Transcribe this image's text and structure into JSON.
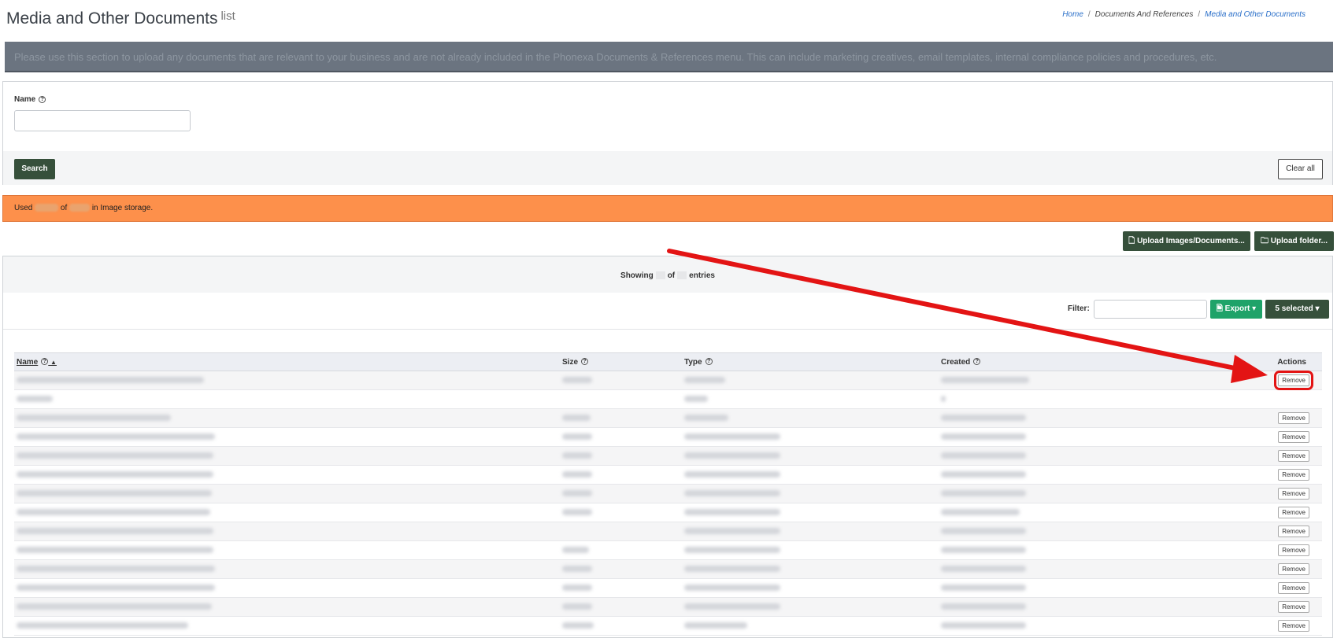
{
  "header": {
    "title": "Media and Other Documents",
    "subtitle": "list",
    "breadcrumb": [
      "Home",
      "Documents And References",
      "Media and Other Documents"
    ]
  },
  "info_banner": "Please use this section to upload any documents that are relevant to your business and are not already included in the Phonexa Documents & References menu. This can include marketing creatives, email templates, internal compliance policies and procedures, etc.",
  "search": {
    "name_label": "Name",
    "name_placeholder": "",
    "search_button": "Search",
    "clear_button": "Clear all"
  },
  "storage_alert": {
    "prefix": "Used",
    "of": "of",
    "suffix": "in Image storage."
  },
  "upload": {
    "images_button": "Upload Images/Documents...",
    "folder_button": "Upload folder..."
  },
  "list": {
    "showing_prefix": "Showing",
    "showing_of": "of",
    "showing_suffix": "entries",
    "filter_label": "Filter:",
    "export_button": "Export",
    "selected_button": "5 selected",
    "columns": [
      "Name",
      "Size",
      "Type",
      "Created",
      "Actions"
    ],
    "rows": [
      {
        "action": "Remove"
      },
      {
        "action": ""
      },
      {
        "action": "Remove"
      },
      {
        "action": "Remove"
      },
      {
        "action": "Remove"
      },
      {
        "action": "Remove"
      },
      {
        "action": "Remove"
      },
      {
        "action": "Remove"
      },
      {
        "action": "Remove"
      },
      {
        "action": "Remove"
      },
      {
        "action": "Remove"
      },
      {
        "action": "Remove"
      },
      {
        "action": "Remove"
      },
      {
        "action": "Remove"
      }
    ]
  },
  "annotation": {
    "arrow_color": "#e31414"
  }
}
